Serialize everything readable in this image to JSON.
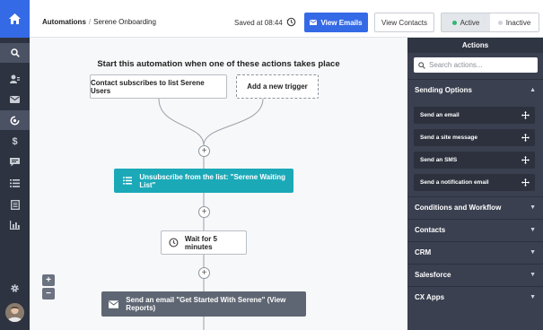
{
  "breadcrumb": {
    "root": "Automations",
    "separator": "/",
    "current": "Serene Onboarding"
  },
  "header": {
    "saved_text": "Saved at 08:44",
    "view_emails_label": "View Emails",
    "view_contacts_label": "View Contacts",
    "status_toggle": {
      "active_label": "Active",
      "inactive_label": "Inactive",
      "selected": "Active"
    }
  },
  "nav": {
    "items": [
      "home",
      "search",
      "contacts",
      "campaigns",
      "automations",
      "deals",
      "conversations",
      "lists",
      "forms",
      "reports",
      "settings"
    ],
    "active": "automations"
  },
  "canvas": {
    "title": "Start this automation when one of these actions takes place",
    "triggers": [
      {
        "label": "Contact subscribes to list Serene Users"
      },
      {
        "label": "Add a new trigger"
      }
    ],
    "steps": [
      {
        "type": "list-action",
        "label": "Unsubscribe from the list: \"Serene Waiting List\""
      },
      {
        "type": "wait",
        "label": "Wait for 5 minutes"
      },
      {
        "type": "email",
        "label": "Send an email \"Get Started With Serene\" (View Reports)"
      }
    ],
    "add_symbol": "+",
    "zoom_in": "+",
    "zoom_out": "−"
  },
  "panel": {
    "title": "Actions",
    "search_placeholder": "Search actions...",
    "sections": [
      {
        "label": "Sending Options",
        "expanded": true,
        "actions": [
          "Send an email",
          "Send a site message",
          "Send an SMS",
          "Send a notification email"
        ]
      },
      {
        "label": "Conditions and Workflow",
        "expanded": false
      },
      {
        "label": "Contacts",
        "expanded": false
      },
      {
        "label": "CRM",
        "expanded": false
      },
      {
        "label": "Salesforce",
        "expanded": false
      },
      {
        "label": "CX Apps",
        "expanded": false
      }
    ]
  },
  "colors": {
    "primary": "#356ae6",
    "nav_bg": "#2d3340",
    "teal_step": "#1ba9b8",
    "email_step": "#5f6673",
    "panel_bg": "#3a4050",
    "active_dot": "#2eb872"
  }
}
